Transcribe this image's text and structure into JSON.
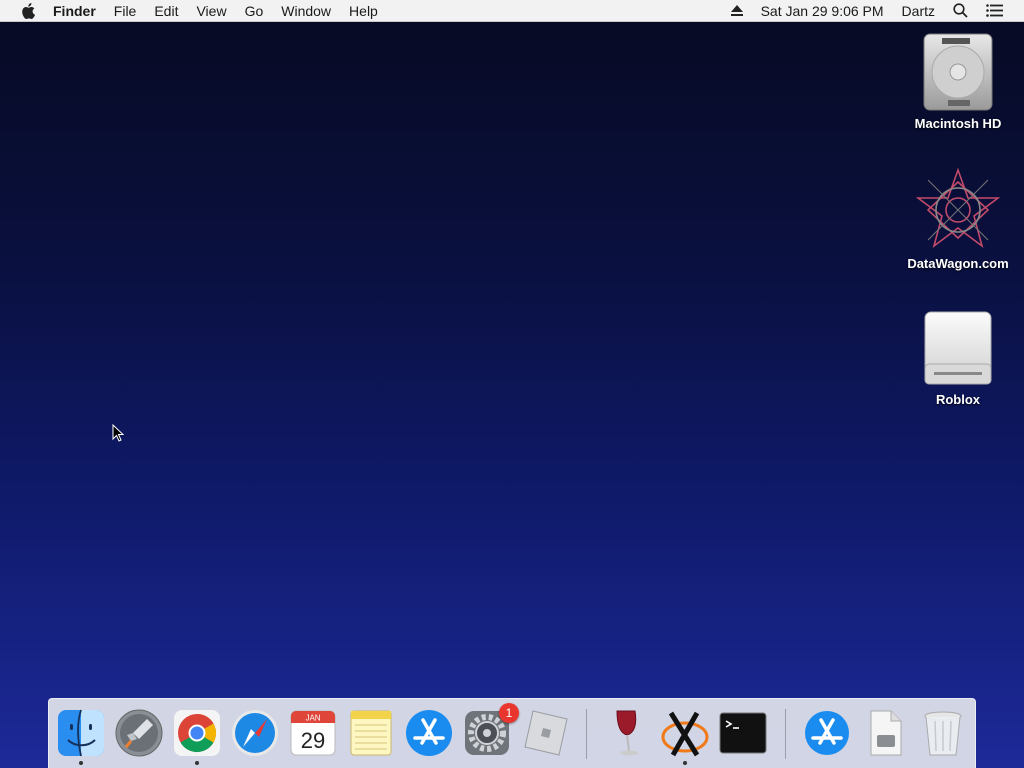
{
  "menubar": {
    "app_name": "Finder",
    "menus": [
      "File",
      "Edit",
      "View",
      "Go",
      "Window",
      "Help"
    ],
    "datetime": "Sat Jan 29  9:06 PM",
    "user": "Dartz"
  },
  "desktop": {
    "icons": [
      {
        "label": "Macintosh HD",
        "icon": "hard-drive-icon"
      },
      {
        "label": "DataWagon.com",
        "icon": "datawagon-icon"
      },
      {
        "label": "Roblox",
        "icon": "external-drive-icon"
      }
    ]
  },
  "dock": {
    "items": [
      {
        "name": "Finder",
        "icon": "finder-icon",
        "running": true
      },
      {
        "name": "Launchpad",
        "icon": "launchpad-icon",
        "running": false
      },
      {
        "name": "Google Chrome",
        "icon": "chrome-icon",
        "running": true
      },
      {
        "name": "Safari",
        "icon": "safari-icon",
        "running": false
      },
      {
        "name": "Calendar",
        "icon": "calendar-icon",
        "running": false,
        "month": "JAN",
        "day": "29"
      },
      {
        "name": "Notes",
        "icon": "notes-icon",
        "running": false
      },
      {
        "name": "App Store",
        "icon": "app-store-icon",
        "running": false
      },
      {
        "name": "System Preferences",
        "icon": "system-preferences-icon",
        "running": false,
        "badge": "1"
      },
      {
        "name": "Roblox",
        "icon": "roblox-icon",
        "running": false
      },
      {
        "name": "Wine",
        "icon": "wine-icon",
        "running": false
      },
      {
        "name": "XQuartz",
        "icon": "xquartz-icon",
        "running": true
      },
      {
        "name": "Terminal",
        "icon": "terminal-icon",
        "running": false
      },
      {
        "name": "App Store Downloads",
        "icon": "app-store-folder-icon",
        "running": false
      },
      {
        "name": "Documents",
        "icon": "document-stack-icon",
        "running": false
      },
      {
        "name": "Trash",
        "icon": "trash-icon",
        "running": false
      }
    ]
  },
  "colors": {
    "desktop_top": "#070a22",
    "desktop_bottom": "#1d2a99",
    "badge": "#e8362f"
  }
}
